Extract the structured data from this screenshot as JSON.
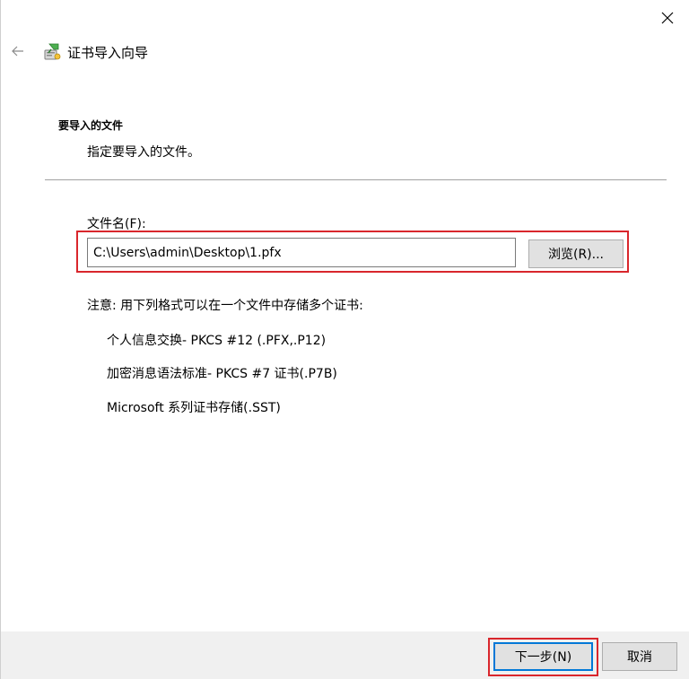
{
  "window": {
    "title": "证书导入向导",
    "close_icon": "close-icon",
    "back_icon": "back-arrow-icon",
    "title_icon": "certificate-wizard-icon"
  },
  "page": {
    "heading": "要导入的文件",
    "subheading": "指定要导入的文件。"
  },
  "file": {
    "label": "文件名(F):",
    "value": "C:\\Users\\admin\\Desktop\\1.pfx",
    "browse_label": "浏览(R)..."
  },
  "note": {
    "text": "注意: 用下列格式可以在一个文件中存储多个证书:",
    "formats": [
      "个人信息交换- PKCS #12 (.PFX,.P12)",
      "加密消息语法标准- PKCS #7 证书(.P7B)",
      "Microsoft 系列证书存储(.SST)"
    ]
  },
  "footer": {
    "next_label": "下一步(N)",
    "cancel_label": "取消"
  },
  "colors": {
    "highlight": "#d9262c",
    "footer_bg": "#f0f0f0",
    "focus_border": "#0078d7"
  }
}
